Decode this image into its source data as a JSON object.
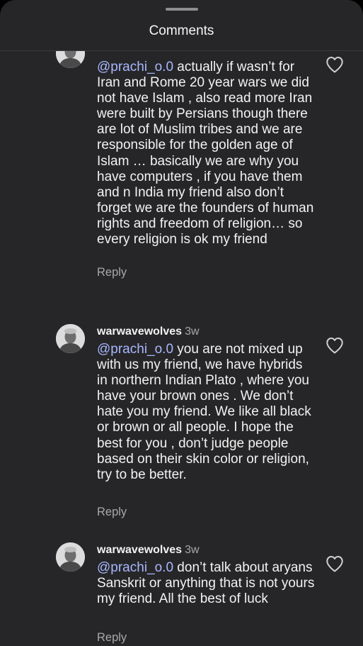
{
  "header": {
    "title": "Comments"
  },
  "comments": [
    {
      "username": "",
      "time": "",
      "mention": "@prachi_o.0",
      "text": " actually if wasn’t for Iran and Rome 20 year wars we did not have Islam , also read more Iran were built by Persians though there are lot of Muslim tribes and we are responsible for the golden age of Islam … basically we are why you have computers , if you have them and n India my friend also don’t forget we are the founders of human rights and freedom of religion… so every religion is ok my friend",
      "reply_label": "Reply"
    },
    {
      "username": "warwavewolves",
      "time": "3w",
      "mention": "@prachi_o.0",
      "text": " you are not mixed up with us my friend, we have hybrids in northern Indian Plato , where you have your brown ones . We don’t hate you my friend. We like all black or brown or all people. I hope the best for you , don’t judge people based on their skin color or religion, try to be better.",
      "reply_label": "Reply"
    },
    {
      "username": "warwavewolves",
      "time": "3w",
      "mention": "@prachi_o.0",
      "text": " don’t talk about aryans Sanskrit or anything that is not yours my friend. All the best of luck",
      "reply_label": "Reply"
    }
  ],
  "icons": {
    "like": "heart-outline-icon",
    "avatar": "profile-photo"
  },
  "colors": {
    "sheet_background": "#262628",
    "text": "#f2f2f2",
    "mention": "#a9b7ff",
    "secondary_text": "#a8a8a8"
  }
}
